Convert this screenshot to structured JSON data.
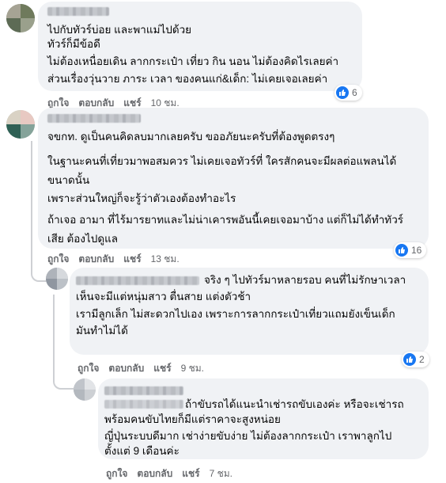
{
  "comments": [
    {
      "lines": [
        "ไปกับทัวร์บ่อย และพาแม่ไปด้วย",
        "ทัวร์ก็มีข้อดี",
        "ไม่ต้องเหนื่อยเดิน ลากกระเป๋า เที่ยว กิน นอน ไม่ต้องคิดไรเลยค่า",
        "ส่วนเรื่องวุ่นวาย ภาระ เวลา ของคนแก่&เด็ก: ไม่เคยเจอเลยค่า"
      ],
      "reactions": "6",
      "like_label": "ถูกใจ",
      "reply_label": "ตอบกลับ",
      "share_label": "แชร์",
      "time": "10 ชม."
    },
    {
      "paragraphs": [
        [
          "จขกท. ดูเป็นคนคิดลบมากเลยครับ ขออภัยนะครับที่ต้องพูดตรงๆ"
        ],
        [
          "ในฐานะคนที่เที่ยวมาพอสมควร ไม่เคยเจอทัวร์ที่ ใครสักคนจะมีผลต่อแพลนได้",
          "ขนาดนั้น"
        ],
        [
          "เพราะส่วนใหญ่ก็จะรู้ว่าตัวเองต้องทำอะไร"
        ],
        [
          "ถ้าเจอ อามา ที่ไร้มารยาทและไม่น่าเคารพอันนี้เคยเจอมาบ้าง แต่ก็ไม่ได้ทำทัวร์",
          "เสีย ต้องไปดูแล"
        ]
      ],
      "reactions": "16",
      "like_label": "ถูกใจ",
      "reply_label": "ตอบกลับ",
      "share_label": "แชร์",
      "time": "13 ชม."
    },
    {
      "first_line": "จริง ๆ ไปทัวร์มาหลายรอบ คนที่ไม่รักษาเวลา",
      "lines": [
        "เห็นจะมีแต่หนุ่มสาว ตื่นสาย แต่งตัวช้า",
        "เรามีลูกเล็ก ไม่สะดวกไปเอง เพราะการลากกระเป๋าเที่ยวแถมยังเข็นเด็ก",
        "มันทำไม่ได้"
      ],
      "reactions": "2",
      "like_label": "ถูกใจ",
      "reply_label": "ตอบกลับ",
      "share_label": "แชร์",
      "time": "9 ชม."
    },
    {
      "first_line": "ถ้าขับรถได้แนะนำเช่ารถขับเองค่ะ หรือจะเช่ารถ",
      "lines": [
        "พร้อมคนขับไทยก็มีแต่ราคาจะสูงหน่อย",
        "ญี่ปุ่นระบบดีมาก เช่าง่ายขับง่าย ไม่ต้องลากกระเป๋า เราพาลูกไป",
        "ตั้งแต่ 9 เดือนค่ะ"
      ],
      "like_label": "ถูกใจ",
      "reply_label": "ตอบกลับ",
      "share_label": "แชร์",
      "time": "7 ชม."
    }
  ],
  "colors": {
    "bubble": "#f0f2f5",
    "text": "#050505",
    "meta": "#65676b",
    "like_blue": "#1877f2"
  }
}
